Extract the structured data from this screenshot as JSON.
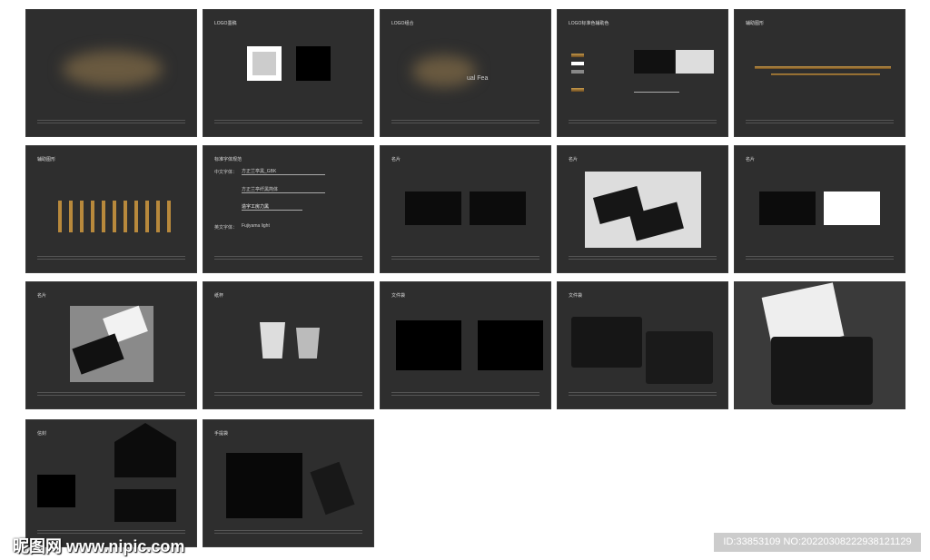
{
  "slides": [
    {
      "title": ""
    },
    {
      "title": "LOGO墨稿"
    },
    {
      "title": "LOGO组合",
      "logo_text": "ual Fea"
    },
    {
      "title": "LOGO标准色辅助色"
    },
    {
      "title": "辅助图形"
    },
    {
      "title": "辅助图形"
    },
    {
      "title": "标准字体规范",
      "cn_label": "中文字体：",
      "fonts": [
        "方正兰亭黑_GBK",
        "方正兰亭纤黑简体",
        "造字工房力黑"
      ],
      "en_label": "英文字体：",
      "en_font": "Fujiyama light"
    },
    {
      "title": "名片"
    },
    {
      "title": "名片"
    },
    {
      "title": "名片"
    },
    {
      "title": "名片"
    },
    {
      "title": "纸杯"
    },
    {
      "title": "文件袋"
    },
    {
      "title": "文件袋"
    },
    {
      "title": ""
    },
    {
      "title": "信封"
    },
    {
      "title": "手提袋"
    }
  ],
  "watermark": "昵图网 www.nipic.com",
  "image_id": "ID:33853109 NO:20220308222938121129",
  "colors": {
    "slide_bg": "#2e2e2e",
    "gold": "#c89a4a"
  }
}
